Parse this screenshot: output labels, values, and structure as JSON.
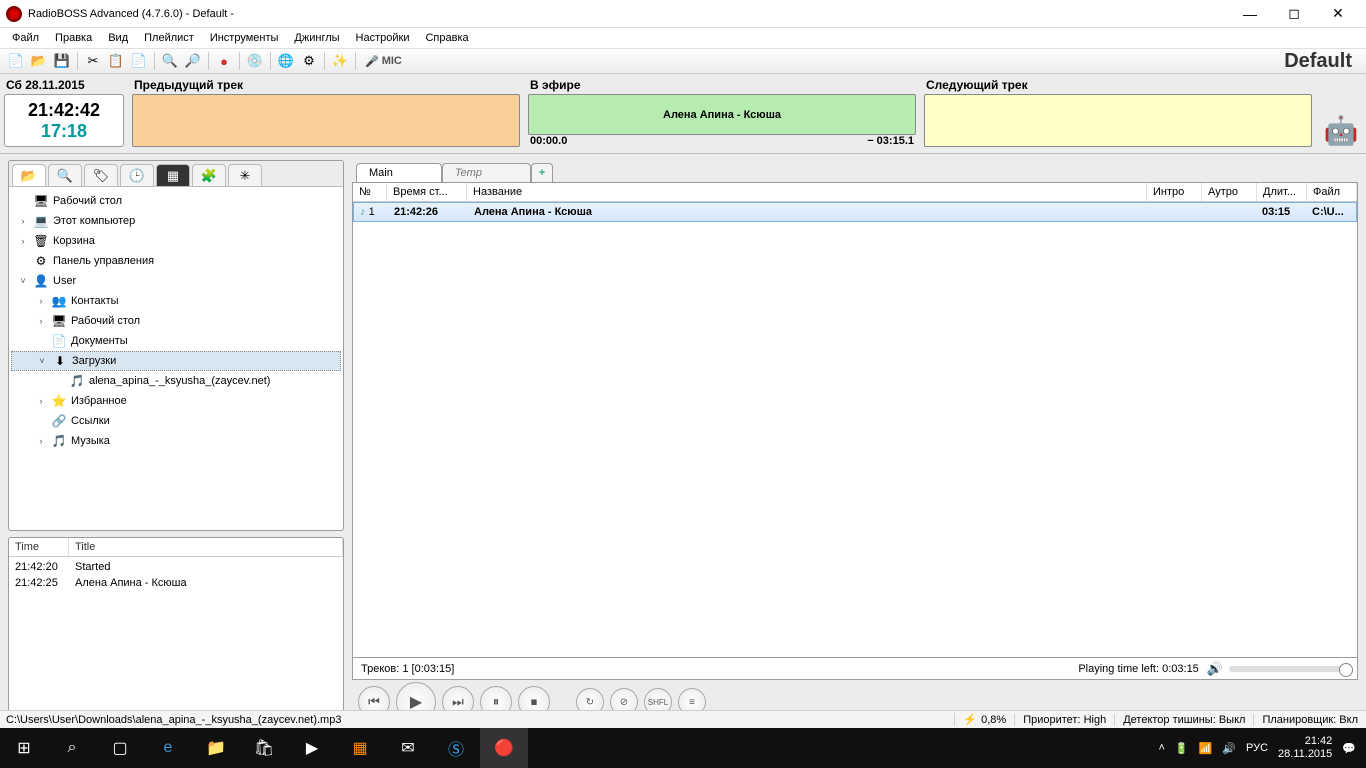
{
  "window": {
    "title": "RadioBOSS Advanced (4.7.6.0) - Default -"
  },
  "menus": [
    "Файл",
    "Правка",
    "Вид",
    "Плейлист",
    "Инструменты",
    "Джинглы",
    "Настройки",
    "Справка"
  ],
  "toolbar": {
    "mic_label": "MIC",
    "profile": "Default"
  },
  "clock": {
    "date": "Сб 28.11.2015",
    "time": "21:42:42",
    "elapsed": "17:18"
  },
  "slots": {
    "prev": {
      "label": "Предыдущий трек",
      "title": ""
    },
    "now": {
      "label": "В эфире",
      "title": "Алена Апина - Ксюша",
      "pos": "00:00.0",
      "remain": "− 03:15.1"
    },
    "next": {
      "label": "Следующий трек",
      "title": ""
    }
  },
  "tree": {
    "items": [
      {
        "indent": 0,
        "chev": "",
        "icon": "🖥",
        "label": "Рабочий стол"
      },
      {
        "indent": 0,
        "chev": "›",
        "icon": "💻",
        "label": "Этот компьютер"
      },
      {
        "indent": 0,
        "chev": "›",
        "icon": "🗑",
        "label": "Корзина"
      },
      {
        "indent": 0,
        "chev": "",
        "icon": "⚙",
        "label": "Панель управления"
      },
      {
        "indent": 0,
        "chev": "˅",
        "icon": "👤",
        "label": "User"
      },
      {
        "indent": 1,
        "chev": "›",
        "icon": "👥",
        "label": "Контакты"
      },
      {
        "indent": 1,
        "chev": "›",
        "icon": "🖥",
        "label": "Рабочий стол"
      },
      {
        "indent": 1,
        "chev": "",
        "icon": "📄",
        "label": "Документы"
      },
      {
        "indent": 1,
        "chev": "˅",
        "icon": "⬇",
        "label": "Загрузки",
        "selected": true
      },
      {
        "indent": 2,
        "chev": "",
        "icon": "🎵",
        "label": "alena_apina_-_ksyusha_(zaycev.net)"
      },
      {
        "indent": 1,
        "chev": "›",
        "icon": "⭐",
        "label": "Избранное"
      },
      {
        "indent": 1,
        "chev": "",
        "icon": "🔗",
        "label": "Ссылки"
      },
      {
        "indent": 1,
        "chev": "›",
        "icon": "🎵",
        "label": "Музыка"
      }
    ]
  },
  "log": {
    "headers": {
      "time": "Time",
      "title": "Title"
    },
    "rows": [
      {
        "time": "21:42:20",
        "title": "Started"
      },
      {
        "time": "21:42:25",
        "title": "Алена Апина - Ксюша"
      }
    ]
  },
  "playlist": {
    "tabs": {
      "main": "Main",
      "temp": "Temp"
    },
    "columns": {
      "n": "№",
      "start": "Время ст...",
      "title": "Название",
      "intro": "Интро",
      "outro": "Аутро",
      "dur": "Длит...",
      "file": "Файл"
    },
    "rows": [
      {
        "n": "1",
        "start": "21:42:26",
        "title": "Алена Апина - Ксюша",
        "intro": "",
        "outro": "",
        "dur": "03:15",
        "file": "C:\\U..."
      }
    ],
    "status_left": "Треков: 1 [0:03:15]",
    "status_right": "Playing time left: 0:03:15"
  },
  "status": {
    "path": "C:\\Users\\User\\Downloads\\alena_apina_-_ksyusha_(zaycev.net).mp3",
    "cpu": "0,8%",
    "priority": "Приоритет: High",
    "silence": "Детектор тишины: Выкл",
    "scheduler": "Планировщик: Вкл"
  },
  "taskbar": {
    "lang": "РУС",
    "time": "21:42",
    "date": "28.11.2015"
  }
}
